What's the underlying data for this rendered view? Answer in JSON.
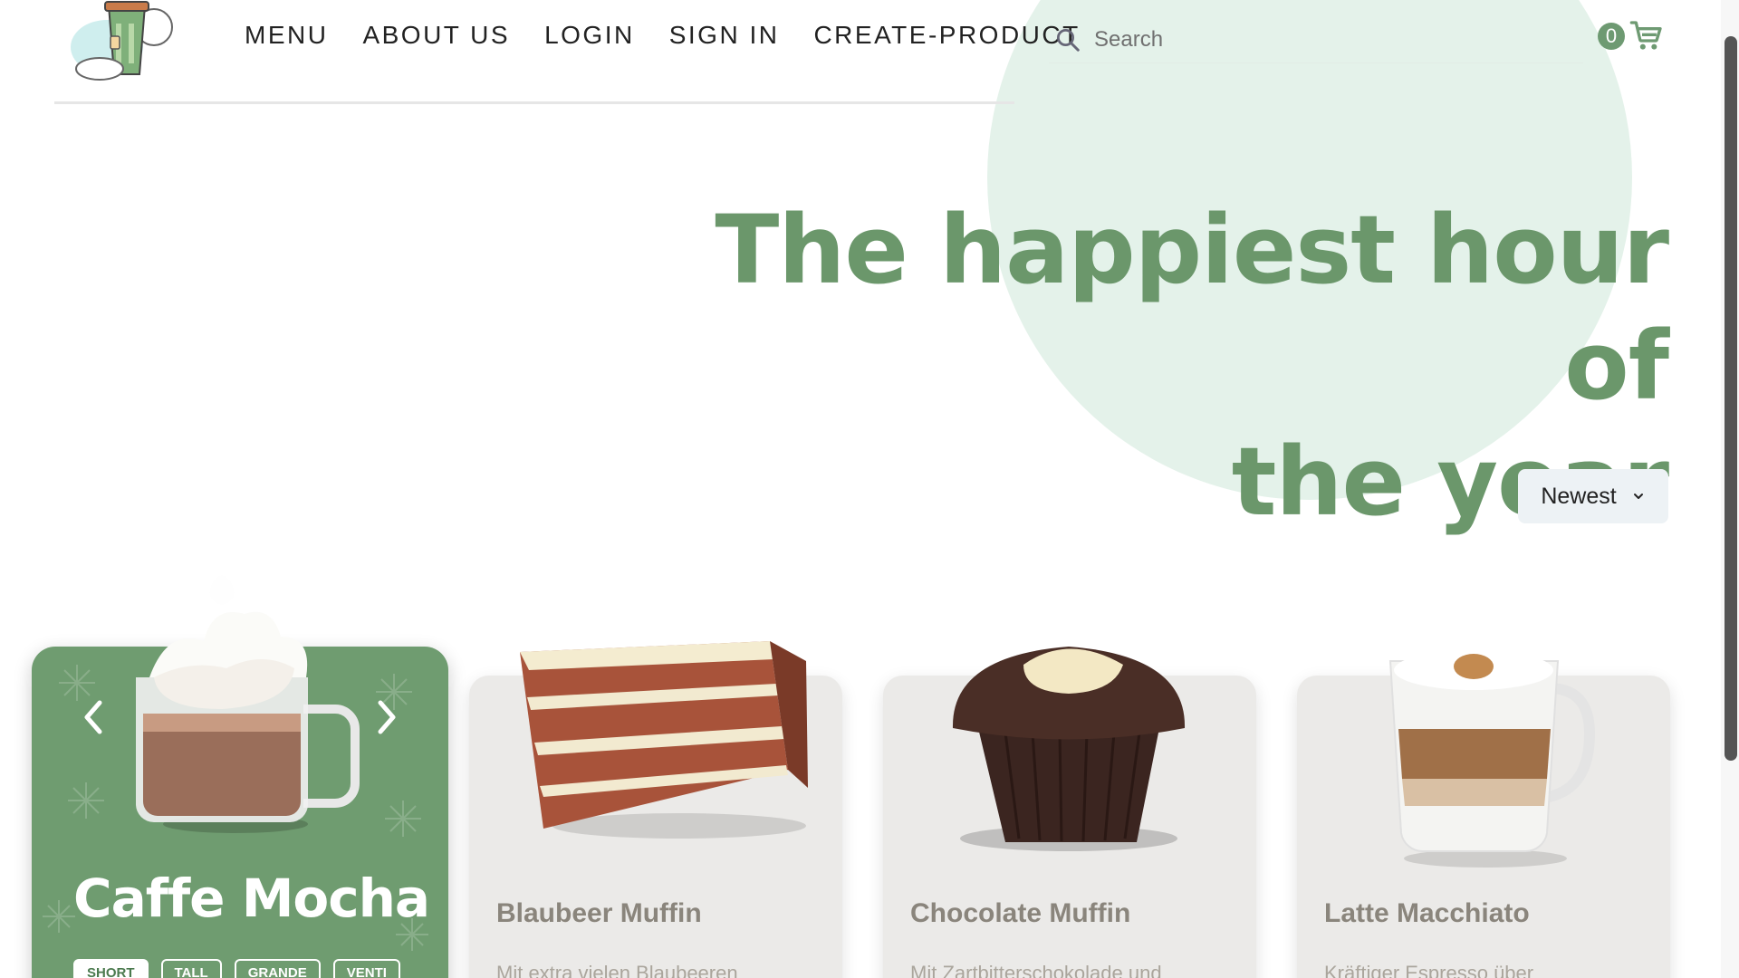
{
  "header": {
    "nav": [
      "MENU",
      "ABOUT US",
      "LOGIN",
      "SIGN IN",
      "CREATE-PRODUCT"
    ],
    "search_placeholder": "Search",
    "cart_count": "0"
  },
  "hero": {
    "line1": "The happiest hour of",
    "line2": "the year"
  },
  "sort": {
    "label": "Newest"
  },
  "featured": {
    "title": "Caffe Mocha",
    "sizes": [
      "SHORT",
      "TALL",
      "GRANDE",
      "VENTI"
    ],
    "selected_size": "SHORT"
  },
  "products": [
    {
      "title": "Blaubeer Muffin",
      "desc": "Mit extra vielen Blaubeeren"
    },
    {
      "title": "Chocolate Muffin",
      "desc": "Mit Zartbitterschokolade und"
    },
    {
      "title": "Latte Macchiato",
      "desc": "Kräftiger Espresso über"
    }
  ],
  "colors": {
    "accent": "#6b976b",
    "circle": "#e4f2ea",
    "card": "#ebeae8"
  }
}
